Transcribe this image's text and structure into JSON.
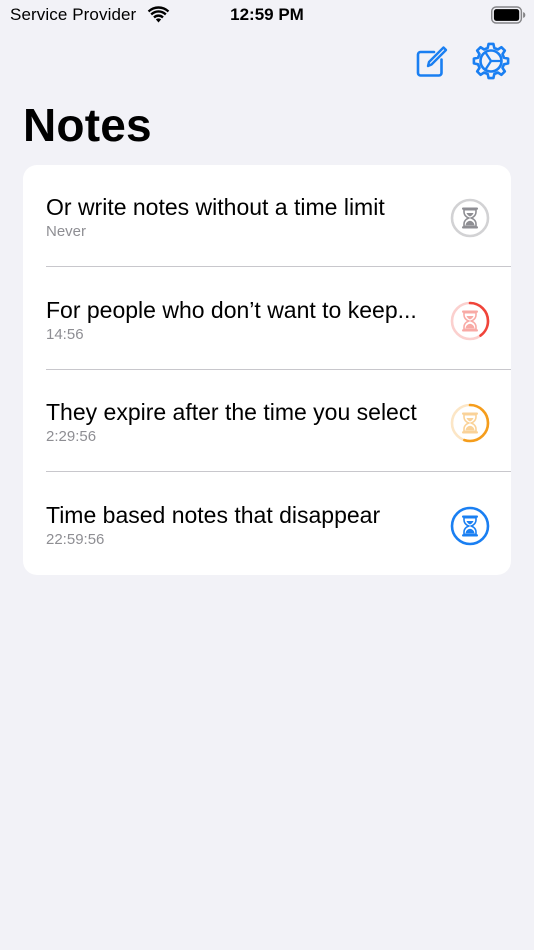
{
  "status_bar": {
    "carrier": "Service Provider",
    "time": "12:59 PM",
    "wifi_icon": "wifi-icon",
    "battery_icon": "battery-icon"
  },
  "nav": {
    "compose_icon": "compose-icon",
    "settings_icon": "settings-icon",
    "accent_color": "#1a7ff2"
  },
  "title": "Notes",
  "notes": [
    {
      "title": "Or write notes without a time limit",
      "time": "Never",
      "icon": "hourglass-icon",
      "color": "#8e8e93",
      "ring_fraction": 0
    },
    {
      "title": "For people who don’t want to keep...",
      "time": "14:56",
      "icon": "hourglass-icon",
      "color": "#f0443a",
      "ring_fraction": 0.4
    },
    {
      "title": "They expire after the time you select",
      "time": "2:29:56",
      "icon": "hourglass-icon",
      "color": "#f59d1c",
      "ring_fraction": 0.55
    },
    {
      "title": "Time based notes that disappear",
      "time": "22:59:56",
      "icon": "hourglass-icon",
      "color": "#1a7ff2",
      "ring_fraction": 1
    }
  ]
}
